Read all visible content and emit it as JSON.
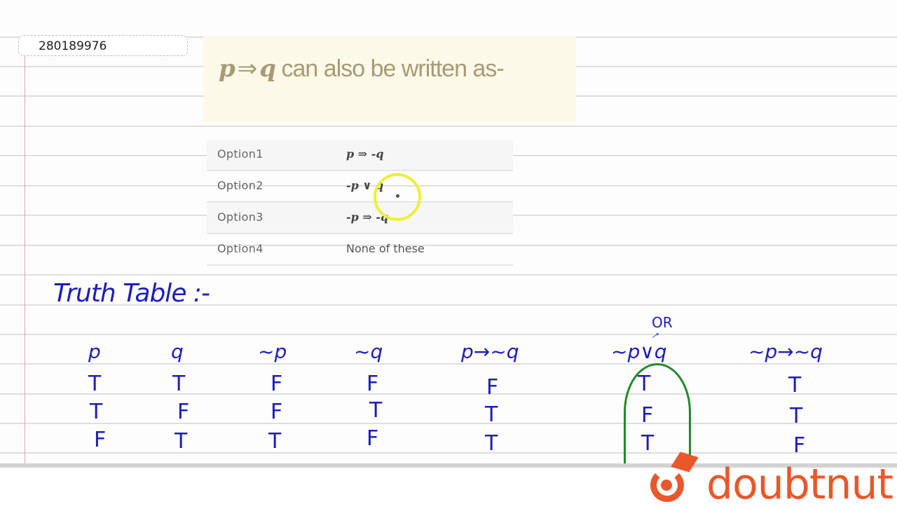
{
  "question_id": "280189976",
  "question": {
    "lhs": "p",
    "arrow": "⇒",
    "rhs": "q",
    "text": "can also be written as-"
  },
  "options": [
    {
      "label": "Option1",
      "value": "p ⇒ -q",
      "is_math": true
    },
    {
      "label": "Option2",
      "value": "-p ∨ q",
      "is_math": true
    },
    {
      "label": "Option3",
      "value": "-p ⇒ -q",
      "is_math": true
    },
    {
      "label": "Option4",
      "value": "None of these",
      "is_math": false
    }
  ],
  "handwritten": {
    "title": "Truth Table :-",
    "annotation": "OR",
    "columns": [
      "p",
      "q",
      "~p",
      "~q",
      "p→~q",
      "~p∨q",
      "~p→~q"
    ],
    "rows": [
      [
        "T",
        "T",
        "F",
        "F",
        "F",
        "T",
        "T"
      ],
      [
        "T",
        "F",
        "F",
        "T",
        "T",
        "F",
        "T"
      ],
      [
        "F",
        "T",
        "T",
        "F",
        "T",
        "T",
        "F"
      ]
    ],
    "highlighted_column": "~p∨q"
  },
  "brand": {
    "name": "doubtnut",
    "color": "#e8582a"
  },
  "colors": {
    "ink": "#1d1db8",
    "highlight_loop": "#1f8a2a",
    "cursor_ring": "#ecef3a",
    "question_bg": "#fcf9e9"
  }
}
